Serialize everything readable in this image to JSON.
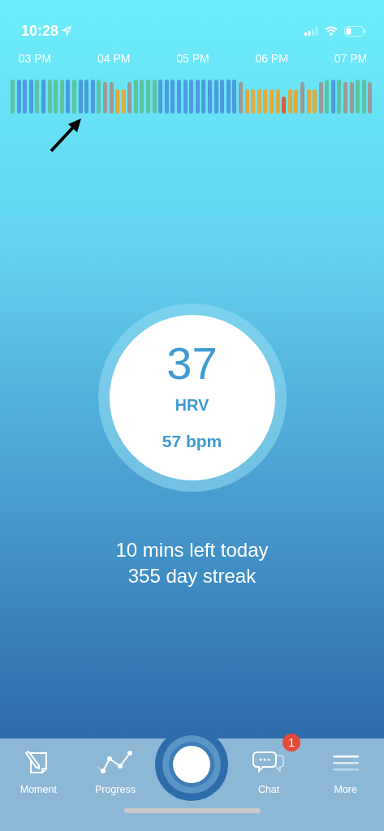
{
  "status_bar": {
    "time": "10:28"
  },
  "timeline": {
    "hour_labels": [
      "03 PM",
      "04 PM",
      "05 PM",
      "06 PM",
      "07 PM"
    ],
    "bars": [
      {
        "color": "#5cc4a0"
      },
      {
        "color": "#4a9be0"
      },
      {
        "color": "#4a9be0"
      },
      {
        "color": "#4a9be0"
      },
      {
        "color": "#5cc4a0"
      },
      {
        "color": "#4a9be0"
      },
      {
        "color": "#5cc4a0"
      },
      {
        "color": "#5cc4a0"
      },
      {
        "color": "#5cc4a0"
      },
      {
        "color": "#4a9be0"
      },
      {
        "color": "#5cc4a0"
      },
      {
        "color": "#4a9be0"
      },
      {
        "color": "#4a9be0"
      },
      {
        "color": "#4a9be0"
      },
      {
        "color": "#5cc4a0"
      },
      {
        "color": "#9a9a9a"
      },
      {
        "color": "#9a9a9a"
      },
      {
        "color": "#e0aa3e"
      },
      {
        "color": "#e0aa3e"
      },
      {
        "color": "#9a9a9a"
      },
      {
        "color": "#5cc4a0"
      },
      {
        "color": "#5cc4a0"
      },
      {
        "color": "#5cc4a0"
      },
      {
        "color": "#5cc4a0"
      },
      {
        "color": "#4a9be0"
      },
      {
        "color": "#4a9be0"
      },
      {
        "color": "#4a9be0"
      },
      {
        "color": "#4a9be0"
      },
      {
        "color": "#4a9be0"
      },
      {
        "color": "#4a9be0"
      },
      {
        "color": "#4a9be0"
      },
      {
        "color": "#4a9be0"
      },
      {
        "color": "#4a9be0"
      },
      {
        "color": "#4a9be0"
      },
      {
        "color": "#4a9be0"
      },
      {
        "color": "#4a9be0"
      },
      {
        "color": "#4a9be0"
      },
      {
        "color": "#9a9a9a"
      },
      {
        "color": "#e0aa3e"
      },
      {
        "color": "#e0aa3e"
      },
      {
        "color": "#e0aa3e"
      },
      {
        "color": "#e0aa3e"
      },
      {
        "color": "#e0aa3e"
      },
      {
        "color": "#e0aa3e"
      },
      {
        "color": "#d4603a"
      },
      {
        "color": "#e0aa3e"
      },
      {
        "color": "#e0aa3e"
      },
      {
        "color": "#9a9a9a"
      },
      {
        "color": "#e0aa3e"
      },
      {
        "color": "#e0aa3e"
      },
      {
        "color": "#9a9a9a"
      },
      {
        "color": "#5cc4a0"
      },
      {
        "color": "#4a9be0"
      },
      {
        "color": "#5cc4a0"
      },
      {
        "color": "#9a9a9a"
      },
      {
        "color": "#9a9a9a"
      },
      {
        "color": "#5cc4a0"
      },
      {
        "color": "#5cc4a0"
      },
      {
        "color": "#9a9a9a"
      }
    ]
  },
  "score": {
    "value": "37",
    "label": "HRV",
    "heart_rate": "57 bpm"
  },
  "summary": [
    "10 mins left today",
    "355 day streak"
  ],
  "nav": [
    {
      "kind": "moment",
      "label": "Moment"
    },
    {
      "kind": "progress",
      "label": "Progress"
    },
    {
      "kind": "record"
    },
    {
      "kind": "chat",
      "label": "Chat",
      "badge": "1"
    },
    {
      "kind": "more",
      "label": "More"
    }
  ]
}
